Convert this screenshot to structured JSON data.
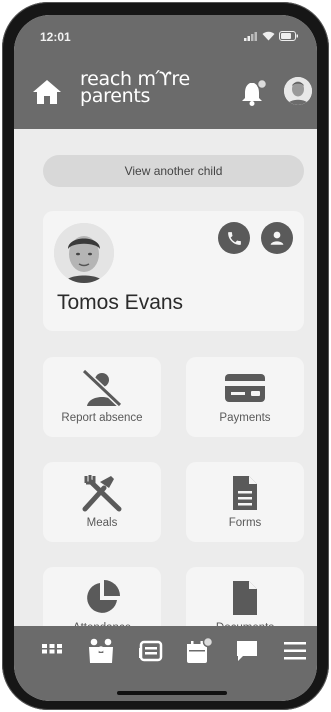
{
  "status_bar": {
    "time": "12:01"
  },
  "header": {
    "logo_line1": "reach mϓre",
    "logo_line2": "parents"
  },
  "view_child": {
    "label": "View another child"
  },
  "child": {
    "name": "Tomos Evans"
  },
  "tiles": [
    {
      "label": "Report absence",
      "icon": "report-absence-icon"
    },
    {
      "label": "Payments",
      "icon": "payments-icon"
    },
    {
      "label": "Meals",
      "icon": "meals-icon"
    },
    {
      "label": "Forms",
      "icon": "forms-icon"
    },
    {
      "label": "Attendance",
      "icon": "attendance-icon"
    },
    {
      "label": "Documents",
      "icon": "documents-icon"
    }
  ],
  "bottom_nav": [
    "grid-icon",
    "family-icon",
    "news-icon",
    "calendar-icon",
    "chat-icon",
    "menu-icon"
  ],
  "colors": {
    "header": "#6b6b6b",
    "background": "#ececec",
    "card": "#f5f5f5",
    "icon": "#5a5a5a"
  }
}
